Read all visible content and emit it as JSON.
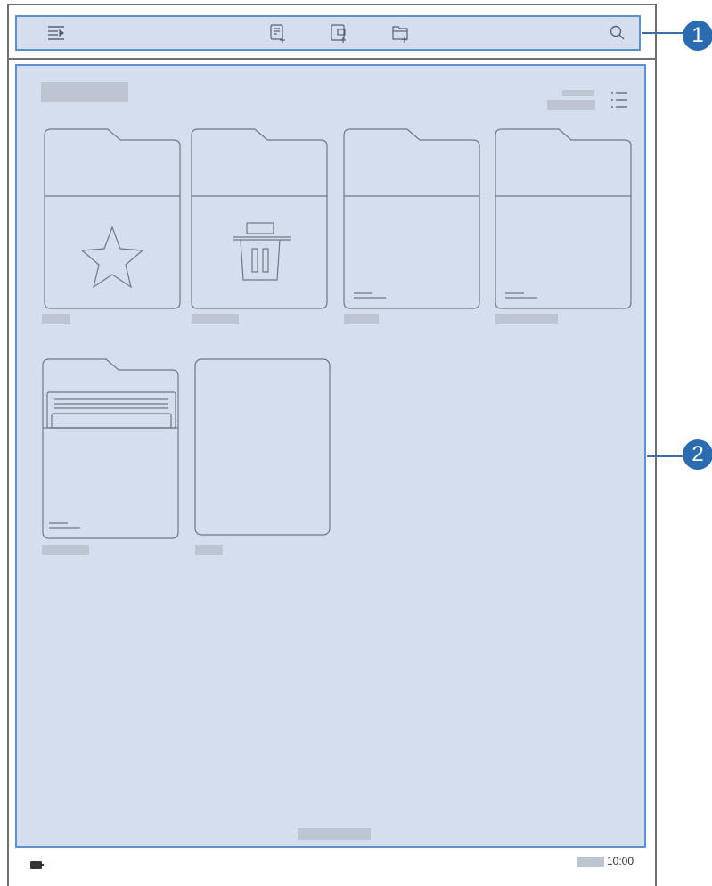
{
  "callouts": {
    "toolbar": "1",
    "file_area": "2"
  },
  "toolbar": {
    "icons": [
      "sidebar-menu-icon",
      "new-note-icon",
      "import-file-icon",
      "new-folder-icon",
      "search-icon"
    ]
  },
  "main": {
    "view_toggle_icon": "list-view-icon",
    "folders": [
      {
        "kind": "favorites",
        "icon": "star-icon"
      },
      {
        "kind": "trash",
        "icon": "trash-icon"
      },
      {
        "kind": "folder"
      },
      {
        "kind": "folder"
      },
      {
        "kind": "folder-with-documents"
      },
      {
        "kind": "notebook"
      }
    ]
  },
  "status_bar": {
    "time": "10:00",
    "battery_icon": "battery-icon"
  },
  "colors": {
    "panel": "#d4deee",
    "highlight_border": "#5e90cf",
    "callout": "#2b6cb0",
    "outline": "#707784",
    "placeholder": "#bdc5d2"
  }
}
